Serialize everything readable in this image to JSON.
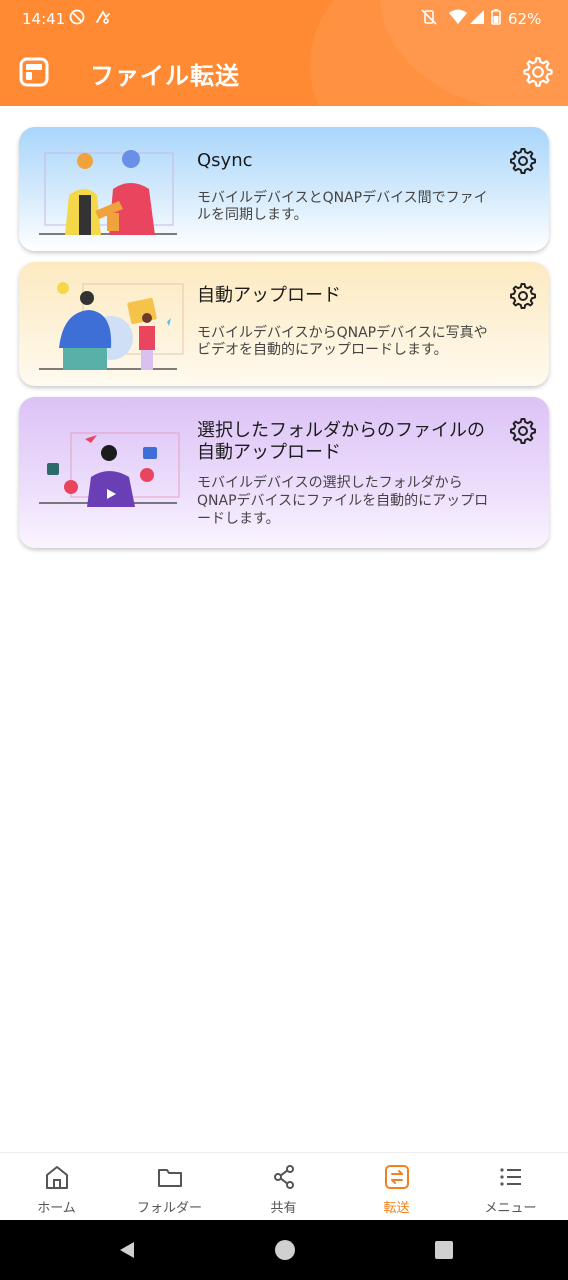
{
  "status_bar": {
    "time": "14:41",
    "battery": "62%"
  },
  "app_bar": {
    "title": "ファイル転送"
  },
  "cards": [
    {
      "title": "Qsync",
      "description_line1": "モバイルデバイスとQNAPデバイス間でファイ",
      "description_line2": "ルを同期します。"
    },
    {
      "title": "自動アップロード",
      "description_line1": "モバイルデバイスからQNAPデバイスに写真や",
      "description_line2": "ビデオを自動的にアップロードします。"
    },
    {
      "title_line1": "選択したフォルダからのファイルの",
      "title_line2": "自動アップロード",
      "description_line1": "モバイルデバイスの選択したフォルダから",
      "description_line2": "QNAPデバイスにファイルを自動的にアップロ",
      "description_line3": "ードします。"
    }
  ],
  "bottom_nav": [
    {
      "label": "ホーム",
      "icon": "home-icon"
    },
    {
      "label": "フォルダー",
      "icon": "folder-icon"
    },
    {
      "label": "共有",
      "icon": "share-icon"
    },
    {
      "label": "転送",
      "icon": "transfer-icon",
      "active": true
    },
    {
      "label": "メニュー",
      "icon": "menu-list-icon"
    }
  ],
  "colors": {
    "brand_orange": "#ff8a33",
    "active_nav": "#f77f1b"
  }
}
